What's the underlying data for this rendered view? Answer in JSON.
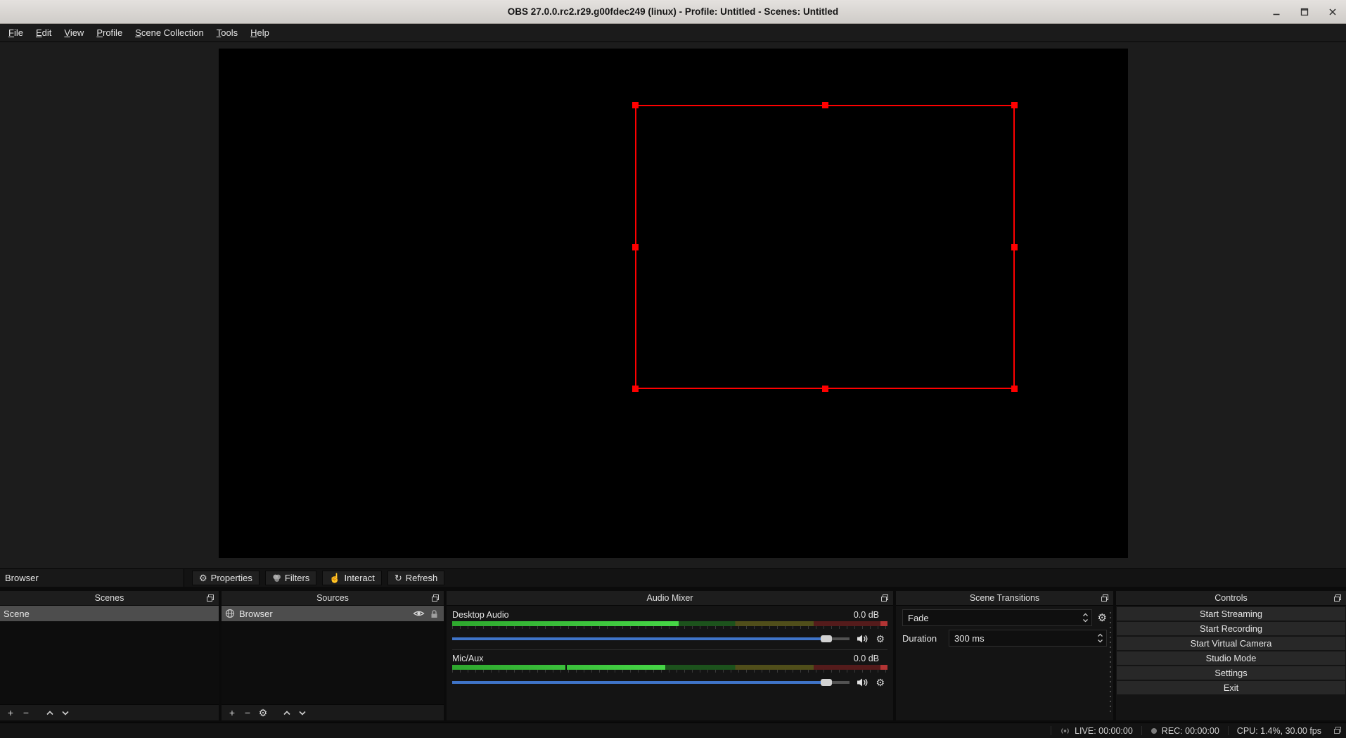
{
  "titlebar": {
    "title": "OBS 27.0.0.rc2.r29.g00fdec249 (linux) - Profile: Untitled - Scenes: Untitled"
  },
  "menubar": {
    "items": [
      "File",
      "Edit",
      "View",
      "Profile",
      "Scene Collection",
      "Tools",
      "Help"
    ]
  },
  "source_toolbar": {
    "context_label": "Browser",
    "buttons": [
      {
        "label": "Properties",
        "icon": "gear-icon"
      },
      {
        "label": "Filters",
        "icon": "filters-icon"
      },
      {
        "label": "Interact",
        "icon": "interact-hand-icon"
      },
      {
        "label": "Refresh",
        "icon": "refresh-icon"
      }
    ]
  },
  "docks": {
    "scenes": {
      "title": "Scenes",
      "items": [
        {
          "label": "Scene",
          "selected": true
        }
      ]
    },
    "sources": {
      "title": "Sources",
      "items": [
        {
          "label": "Browser",
          "icon": "globe-icon",
          "selected": true,
          "visible": true,
          "locked": false
        }
      ]
    },
    "audio_mixer": {
      "title": "Audio Mixer",
      "channels": [
        {
          "name": "Desktop Audio",
          "level": "0.0 dB",
          "meter_percent": 52,
          "slider_percent": 94
        },
        {
          "name": "Mic/Aux",
          "level": "0.0 dB",
          "meter_percent": 49,
          "peak_percent": 26,
          "slider_percent": 94
        }
      ]
    },
    "scene_transitions": {
      "title": "Scene Transitions",
      "transition_value": "Fade",
      "duration_label": "Duration",
      "duration_value": "300 ms"
    },
    "controls": {
      "title": "Controls",
      "buttons": [
        "Start Streaming",
        "Start Recording",
        "Start Virtual Camera",
        "Studio Mode",
        "Settings",
        "Exit"
      ]
    }
  },
  "statusbar": {
    "live": "LIVE: 00:00:00",
    "rec": "REC: 00:00:00",
    "stats": "CPU: 1.4%, 30.00 fps"
  },
  "icons": {
    "gear": "⚙",
    "plus": "+",
    "minus": "−",
    "interact_hand": "☝",
    "refresh": "↻"
  },
  "colors": {
    "selection_red": "#ff0000",
    "slider_blue": "#3f74c8",
    "meter_green": "#46d646",
    "selected_row": "#4d4d4d"
  }
}
